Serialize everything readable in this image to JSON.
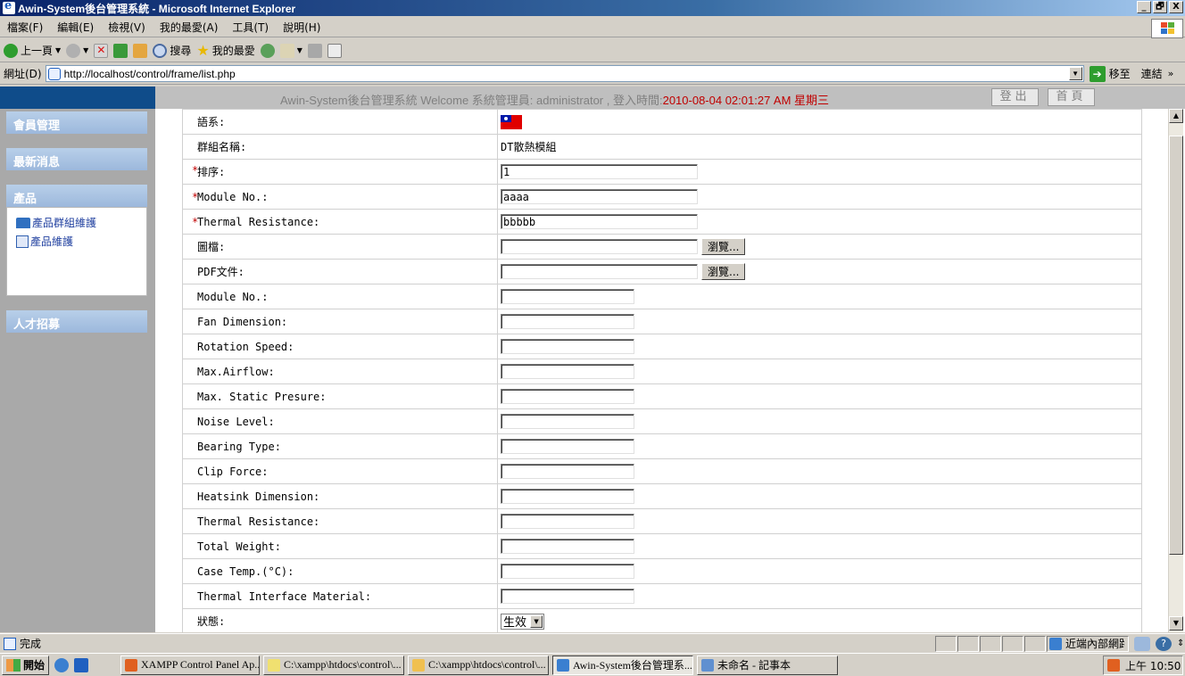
{
  "window": {
    "title": "Awin-System後台管理系統 - Microsoft Internet Explorer",
    "controls": [
      "_",
      "🗗",
      "X"
    ]
  },
  "menubar": {
    "items": [
      "檔案(F)",
      "編輯(E)",
      "檢視(V)",
      "我的最愛(A)",
      "工具(T)",
      "說明(H)"
    ]
  },
  "toolbar": {
    "back_label": "上一頁",
    "search_label": "搜尋",
    "favorites_label": "我的最愛"
  },
  "addressbar": {
    "label": "網址(D)",
    "url": "http://localhost/control/frame/list.php",
    "go_label": "移至",
    "links_label": "連結",
    "more": "»"
  },
  "header": {
    "welcome": "Awin-System後台管理系統  Welcome 系統管理員: administrator ,  登入時間:",
    "login_time": "2010-08-04 02:01:27 AM 星期三",
    "logout_label": "登出",
    "home_label": "首頁"
  },
  "sidebar": {
    "categories": [
      "會員管理",
      "最新消息",
      "產品",
      "人才招募"
    ],
    "product_links": [
      "產品群組維護",
      "產品維護"
    ]
  },
  "form": {
    "language_label": "語系:",
    "group_label": "群組名稱:",
    "group_value": "DT散熱模組",
    "order_label": "排序:",
    "order_value": "1",
    "module_no_label": "Module No.:",
    "module_no_value": "aaaa",
    "thermal_res_label": "Thermal Resistance:",
    "thermal_res_value": "bbbbb",
    "image_label": "圖檔:",
    "pdf_label": "PDF文件:",
    "browse_label": "瀏覽...",
    "spec_labels": [
      "Module No.:",
      "Fan Dimension:",
      "Rotation Speed:",
      "Max.Airflow:",
      "Max. Static Presure:",
      "Noise Level:",
      "Bearing Type:",
      "Clip Force:",
      "Heatsink Dimension:",
      "Thermal Resistance:",
      "Total Weight:",
      "Case Temp.(°C):",
      "Thermal Interface Material:"
    ],
    "status_label": "狀態:",
    "status_value": "生效",
    "required_mark": "*"
  },
  "statusbar": {
    "text": "完成",
    "zone": "近端內部網路"
  },
  "taskbar": {
    "start_label": "開始",
    "tasks": [
      "XAMPP Control Panel Ap...",
      "C:\\xampp\\htdocs\\control\\...",
      "C:\\xampp\\htdocs\\control\\...",
      "Awin-System後台管理系...",
      "未命名 - 記事本"
    ],
    "clock": "上午 10:50"
  }
}
